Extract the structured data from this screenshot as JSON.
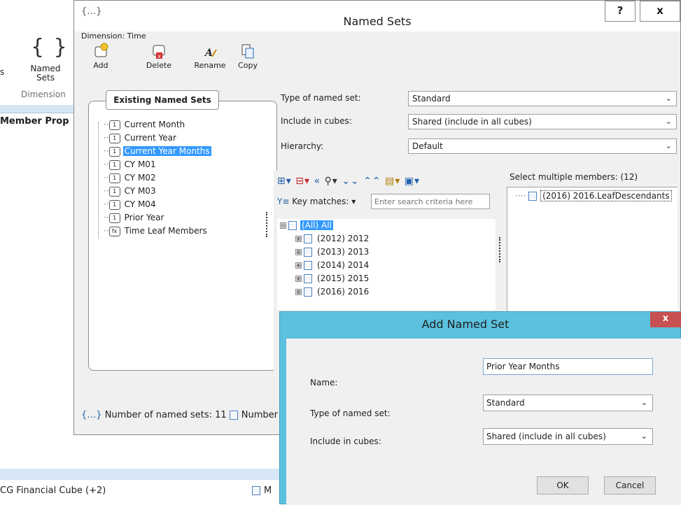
{
  "background_app": {
    "ribbon_s": "s",
    "named_sets_label": "Named\nSets",
    "group_label": "Dimension",
    "member_prop": "Member Prop",
    "cube_tab": "CG Financial Cube (+2)",
    "bottom_right": "M"
  },
  "named_sets_dialog": {
    "title": "Named Sets",
    "help_label": "?",
    "close_label": "x",
    "dimension_label": "Dimension: Time",
    "toolbar": {
      "add": "Add",
      "delete": "Delete",
      "rename": "Rename",
      "copy": "Copy"
    },
    "existing_header": "Existing Named Sets",
    "existing_sets": [
      {
        "label": "Current Month",
        "selected": false,
        "icon": "set-icon"
      },
      {
        "label": "Current Year",
        "selected": false,
        "icon": "set-icon"
      },
      {
        "label": "Current Year Months",
        "selected": true,
        "icon": "set-icon"
      },
      {
        "label": "CY M01",
        "selected": false,
        "icon": "set-icon"
      },
      {
        "label": "CY M02",
        "selected": false,
        "icon": "set-icon"
      },
      {
        "label": "CY M03",
        "selected": false,
        "icon": "set-icon"
      },
      {
        "label": "CY M04",
        "selected": false,
        "icon": "set-icon"
      },
      {
        "label": "Prior Year",
        "selected": false,
        "icon": "set-icon"
      },
      {
        "label": "Time Leaf Members",
        "selected": false,
        "icon": "formula-set-icon"
      }
    ],
    "type_label": "Type of named set:",
    "type_value": "Standard",
    "include_label": "Include in cubes:",
    "include_value": "Shared (include in all cubes)",
    "hierarchy_label": "Hierarchy:",
    "hierarchy_value": "Default",
    "key_matches_label": "Key matches:",
    "search_placeholder": "Enter search criteria here",
    "members": [
      {
        "label": "(All) All",
        "expander": "⊟",
        "selected": true
      },
      {
        "label": "(2012) 2012",
        "expander": "⊞",
        "selected": false
      },
      {
        "label": "(2013) 2013",
        "expander": "⊞",
        "selected": false
      },
      {
        "label": "(2014) 2014",
        "expander": "⊞",
        "selected": false
      },
      {
        "label": "(2015) 2015",
        "expander": "⊞",
        "selected": false
      },
      {
        "label": "(2016) 2016",
        "expander": "⊞",
        "selected": false
      }
    ],
    "select_multiple_label": "Select multiple members: (12)",
    "selected_members": [
      "(2016) 2016.LeafDescendants"
    ],
    "status_text": "Number of named sets: 11",
    "status_text_2": "Number"
  },
  "add_dialog": {
    "title": "Add Named Set",
    "close_label": "x",
    "name_label": "Name:",
    "name_value": "Prior Year Months",
    "type_label": "Type of named set:",
    "type_value": "Standard",
    "include_label": "Include in cubes:",
    "include_value": "Shared (include in all cubes)",
    "ok_label": "OK",
    "cancel_label": "Cancel"
  }
}
